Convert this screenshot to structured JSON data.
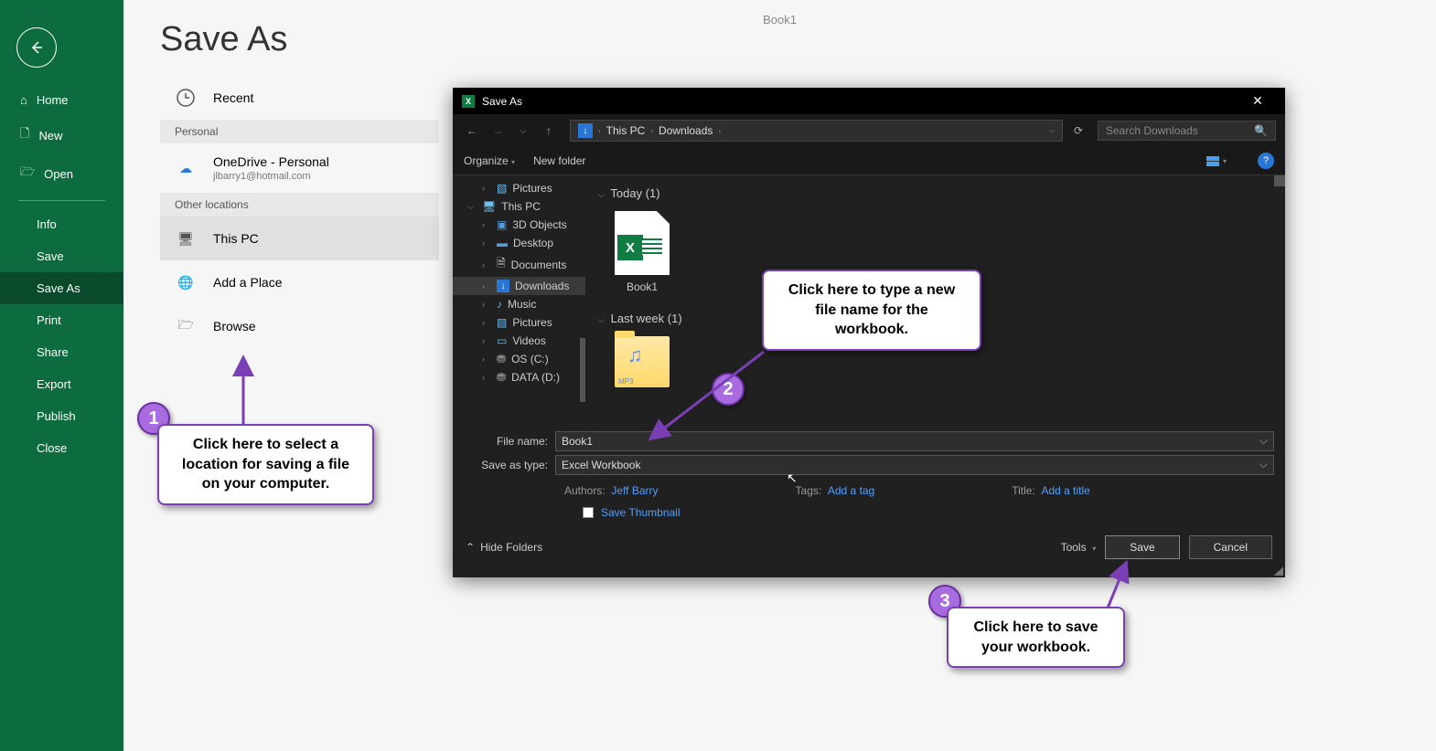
{
  "doc_title": "Book1",
  "page_title": "Save As",
  "sidebar": {
    "home": "Home",
    "new": "New",
    "open": "Open",
    "info": "Info",
    "save": "Save",
    "saveas": "Save As",
    "print": "Print",
    "share": "Share",
    "export": "Export",
    "publish": "Publish",
    "close": "Close"
  },
  "locations": {
    "recent": "Recent",
    "hdr_personal": "Personal",
    "onedrive": "OneDrive - Personal",
    "onedrive_sub": "jlbarry1@hotmail.com",
    "hdr_other": "Other locations",
    "thispc": "This PC",
    "addplace": "Add a Place",
    "browse": "Browse"
  },
  "dialog": {
    "title": "Save As",
    "path_pc": "This PC",
    "path_dl": "Downloads",
    "search_ph": "Search Downloads",
    "organize": "Organize",
    "newfolder": "New folder",
    "tree": {
      "pictures": "Pictures",
      "thispc": "This PC",
      "objects": "3D Objects",
      "desktop": "Desktop",
      "documents": "Documents",
      "downloads": "Downloads",
      "music": "Music",
      "pictures2": "Pictures",
      "videos": "Videos",
      "osc": "OS (C:)",
      "data": "DATA (D:)"
    },
    "group_today": "Today (1)",
    "group_lastweek": "Last week (1)",
    "file1": "Book1",
    "filename_lbl": "File name:",
    "filename_val": "Book1",
    "savetype_lbl": "Save as type:",
    "savetype_val": "Excel Workbook",
    "authors_lbl": "Authors:",
    "authors_val": "Jeff Barry",
    "tags_lbl": "Tags:",
    "tags_val": "Add a tag",
    "title_lbl": "Title:",
    "title_val": "Add a title",
    "thumb": "Save Thumbnail",
    "hide": "Hide Folders",
    "tools": "Tools",
    "save": "Save",
    "cancel": "Cancel"
  },
  "callouts": {
    "c1": "Click here to select a location for saving a file on your computer.",
    "c2": "Click here to type a new file name for the workbook.",
    "c3": "Click here to save your workbook."
  }
}
